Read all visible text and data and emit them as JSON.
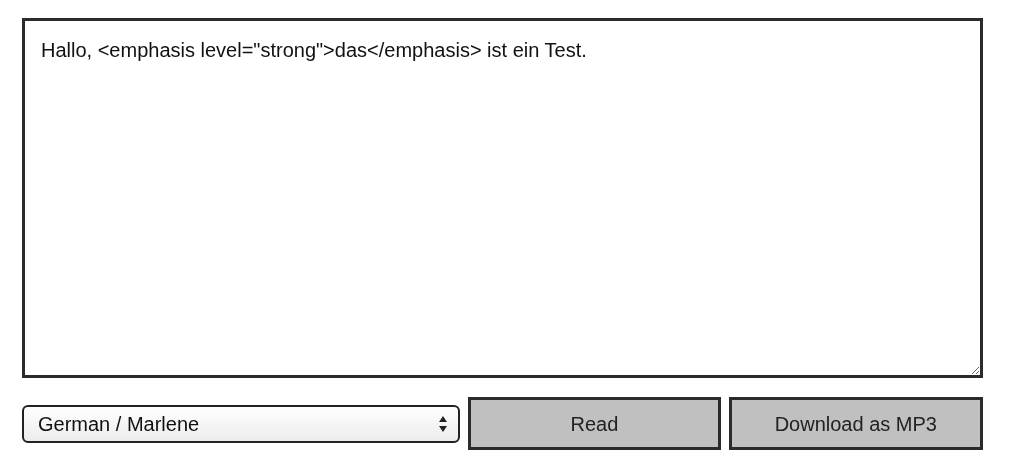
{
  "text_input": {
    "value": "Hallo, <emphasis level=\"strong\">das</emphasis> ist ein Test."
  },
  "voice_select": {
    "value": "German / Marlene"
  },
  "buttons": [
    {
      "label": "Read"
    },
    {
      "label": "Download as MP3"
    }
  ]
}
